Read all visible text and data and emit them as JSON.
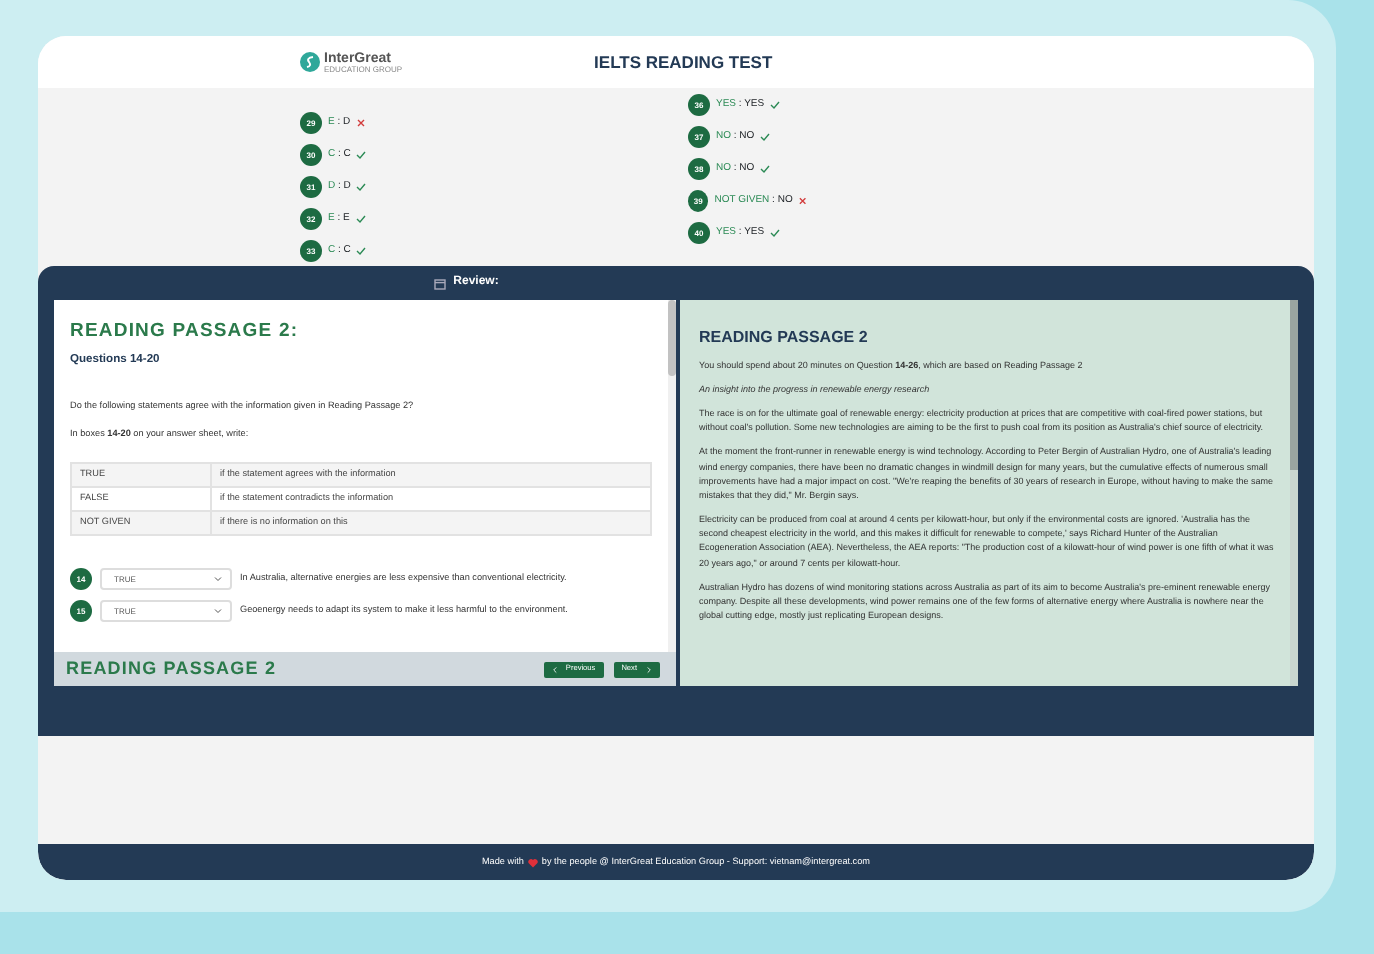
{
  "header": {
    "logo": {
      "name": "InterGreat",
      "tagline": "EDUCATION GROUP"
    },
    "title": "IELTS READING TEST"
  },
  "answers": {
    "columns": [
      [
        {
          "number": "29",
          "answer": "E",
          "separator": ":",
          "key": "D",
          "correct": false
        },
        {
          "number": "30",
          "answer": "C",
          "separator": ":",
          "key": "C",
          "correct": true
        },
        {
          "number": "31",
          "answer": "D",
          "separator": ":",
          "key": "D",
          "correct": true
        },
        {
          "number": "32",
          "answer": "E",
          "separator": ":",
          "key": "E",
          "correct": true
        },
        {
          "number": "33",
          "answer": "C",
          "separator": ":",
          "key": "C",
          "correct": true
        }
      ],
      [
        {
          "number": "36",
          "answer": "YES",
          "separator": ":",
          "key": "YES",
          "correct": true
        },
        {
          "number": "37",
          "answer": "NO",
          "separator": ":",
          "key": "NO",
          "correct": true
        },
        {
          "number": "38",
          "answer": "NO",
          "separator": ":",
          "key": "NO",
          "correct": true
        },
        {
          "number": "39",
          "answer": "NOT GIVEN",
          "separator": ":",
          "key": "NO",
          "correct": false
        },
        {
          "number": "40",
          "answer": "YES",
          "separator": ":",
          "key": "YES",
          "correct": true
        }
      ]
    ]
  },
  "review": {
    "title": "Review:",
    "questions_panel": {
      "heading": "READING PASSAGE 2:",
      "subheading": "Questions 14-20",
      "instructions": [
        "Do the following statements agree with the information given in Reading Passage 2?",
        "In boxes **14-20** on your answer sheet, write:"
      ],
      "legend": [
        {
          "term": "TRUE",
          "meaning": "if the statement agrees with the information"
        },
        {
          "term": "FALSE",
          "meaning": "if the statement contradicts the information"
        },
        {
          "term": "NOT GIVEN",
          "meaning": "if there is no information on this"
        }
      ],
      "questions": [
        {
          "number": "14",
          "value": "TRUE",
          "text": "In Australia, alternative energies are less expensive than conventional electricity."
        },
        {
          "number": "15",
          "value": "TRUE",
          "text": "Geoenergy needs to adapt its system to make it less harmful to the environment."
        }
      ],
      "footer_title": "READING PASSAGE 2",
      "buttons": [
        {
          "kind": "previous",
          "label": "Previous"
        },
        {
          "kind": "next",
          "label": "Next"
        }
      ]
    },
    "passage_panel": {
      "heading": "READING PASSAGE 2",
      "paragraphs": [
        {
          "kind": "text",
          "text": "You should spend about 20 minutes on Question **14-26**, which are based on Reading Passage 2"
        },
        {
          "kind": "subtitle",
          "text": "An insight into the progress in renewable energy research"
        },
        {
          "kind": "text",
          "text": "The race is on for the ultimate goal of renewable energy: electricity production at prices that are competitive with coal-fired power stations, but without coal's pollution. Some new technologies are aiming to be the first to push coal from its position as Australia's chief source of electricity."
        },
        {
          "kind": "text",
          "text": "At the moment the front-runner in renewable energy is wind technology. According to Peter Bergin of Australian Hydro, one of Australia's leading wind energy companies, there have been no dramatic changes in windmill design for many years, but the cumulative effects of numerous small improvements have had a major impact on cost. \"We're reaping the benefits of 30 years of research in Europe, without having to make the same mistakes that they did,\" Mr. Bergin says."
        },
        {
          "kind": "text",
          "text": "Electricity can be produced from coal at around 4 cents per kilowatt-hour, but only if the environmental costs are ignored. 'Australia has the second cheapest electricity in the world, and this makes it difficult for renewable to compete,' says Richard Hunter of the Australian Ecogeneration Association (AEA). Nevertheless, the AEA reports: \"The production cost of a kilowatt-hour of wind power is one fifth of what it was 20 years ago,\" or around 7 cents per kilowatt-hour."
        },
        {
          "kind": "text",
          "text": "Australian Hydro has dozens of wind monitoring stations across Australia as part of its aim to become Australia's pre-eminent renewable energy company. Despite all these developments, wind power remains one of the few forms of alternative energy where Australia is nowhere near the global cutting edge, mostly just replicating European designs."
        }
      ]
    }
  },
  "footer": {
    "before": "Made with",
    "after": "by the people @ InterGreat Education Group - Support: vietnam@intergreat.com"
  }
}
